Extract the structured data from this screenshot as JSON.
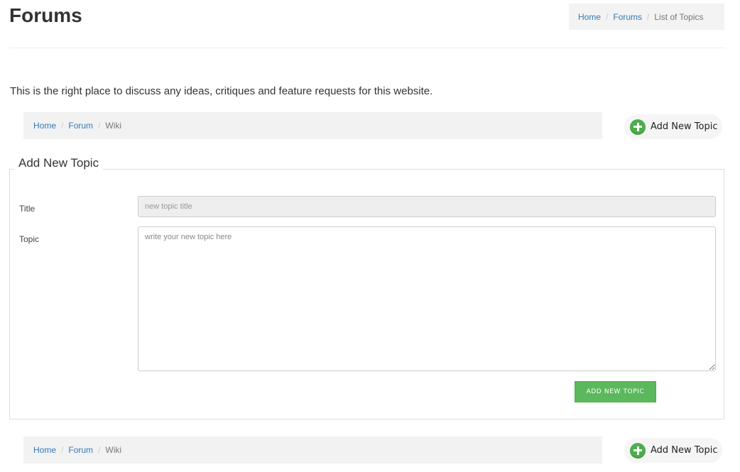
{
  "header": {
    "title": "Forums",
    "breadcrumb": [
      {
        "label": "Home"
      },
      {
        "label": "Forums"
      },
      {
        "label": "List of Topics"
      }
    ],
    "separator": "/"
  },
  "intro": "This is the right place to discuss any ideas, critiques and feature requests for this website.",
  "forum_bar": {
    "breadcrumb": [
      {
        "label": "Home"
      },
      {
        "label": "Forum"
      },
      {
        "label": "Wiki"
      }
    ],
    "add_button_label": "Add New Topic",
    "add_button_icon": "plus-circle-icon"
  },
  "form": {
    "legend": "Add New Topic",
    "title_label": "Title",
    "title_placeholder": "new topic title",
    "title_value": "",
    "topic_label": "Topic",
    "topic_placeholder": "write your new topic here",
    "topic_value": "",
    "submit_label": "ADD NEW TOPIC"
  },
  "colors": {
    "link": "#337ab7",
    "success": "#5cb85c",
    "bar_background": "#f2f2f2"
  }
}
